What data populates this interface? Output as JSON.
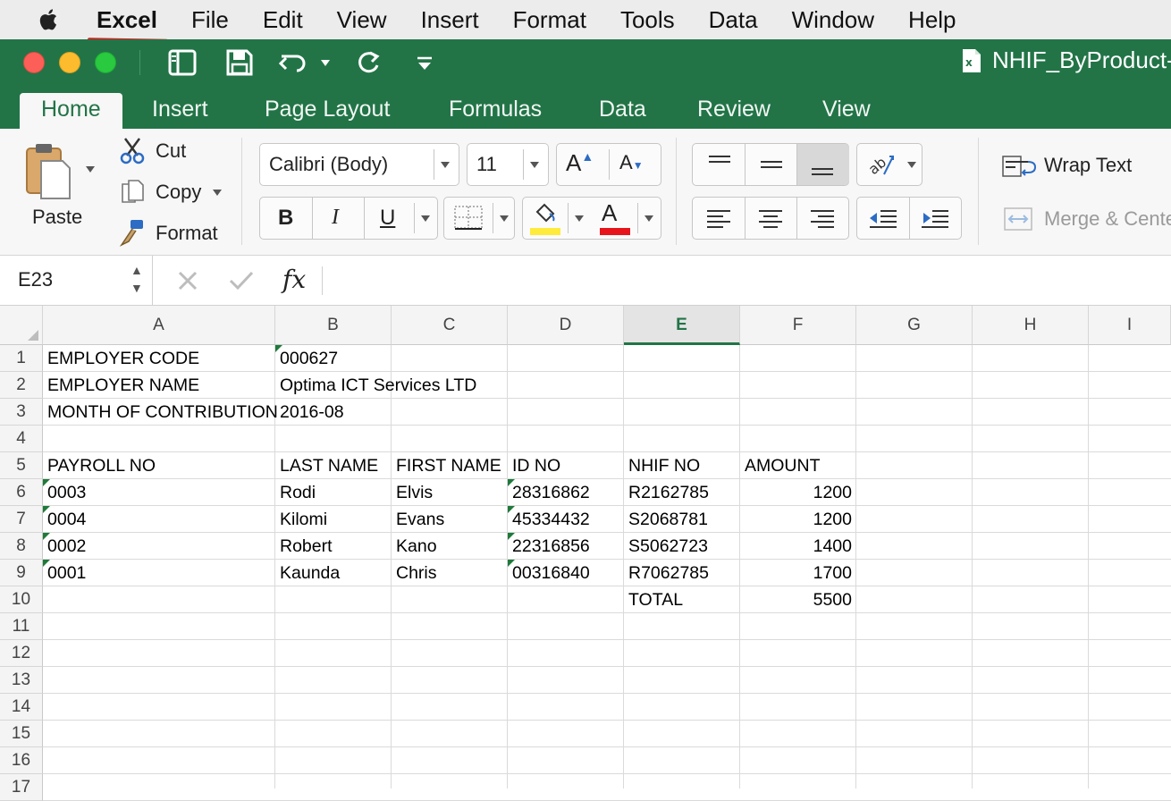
{
  "menubar": {
    "items": [
      "Excel",
      "File",
      "Edit",
      "View",
      "Insert",
      "Format",
      "Tools",
      "Data",
      "Window",
      "Help"
    ]
  },
  "window": {
    "title": "NHIF_ByProduct-"
  },
  "ribbon": {
    "tabs": [
      "Home",
      "Insert",
      "Page Layout",
      "Formulas",
      "Data",
      "Review",
      "View"
    ],
    "active_tab": "Home",
    "paste_label": "Paste",
    "cut_label": "Cut",
    "copy_label": "Copy",
    "format_label": "Format",
    "font_name": "Calibri (Body)",
    "font_size": "11",
    "bold": "B",
    "italic": "I",
    "underline": "U",
    "grow_font": "A",
    "shrink_font": "A",
    "font_color_glyph": "A",
    "wrap_text_label": "Wrap Text",
    "merge_label": "Merge & Cente",
    "highlight_color": "#ffeb3b",
    "font_color": "#e8141b"
  },
  "formula_bar": {
    "name_box": "E23",
    "fx": "fx",
    "value": ""
  },
  "sheet": {
    "columns": [
      "A",
      "B",
      "C",
      "D",
      "E",
      "F",
      "G",
      "H",
      "I"
    ],
    "selected_column": "E",
    "rows": [
      "1",
      "2",
      "3",
      "4",
      "5",
      "6",
      "7",
      "8",
      "9",
      "10",
      "11",
      "12",
      "13",
      "14",
      "15",
      "16",
      "17"
    ],
    "cells": {
      "A1": "EMPLOYER CODE",
      "B1": "000627",
      "A2": "EMPLOYER NAME",
      "B2": "Optima ICT Services LTD",
      "A3": "MONTH OF CONTRIBUTION",
      "B3": "2016-08",
      "A5": "PAYROLL NO",
      "B5": "LAST NAME",
      "C5": "FIRST NAME",
      "D5": "ID NO",
      "E5": "NHIF NO",
      "F5": "AMOUNT",
      "A6": "0003",
      "B6": "Rodi",
      "C6": "Elvis",
      "D6": "28316862",
      "E6": "R2162785",
      "F6": "1200",
      "A7": "0004",
      "B7": "Kilomi",
      "C7": "Evans",
      "D7": "45334432",
      "E7": "S2068781",
      "F7": "1200",
      "A8": "0002",
      "B8": "Robert",
      "C8": "Kano",
      "D8": "22316856",
      "E8": "S5062723",
      "F8": "1400",
      "A9": "0001",
      "B9": "Kaunda",
      "C9": "Chris",
      "D9": "00316840",
      "E9": "R7062785",
      "F9": "1700",
      "E10": "TOTAL",
      "F10": "5500"
    }
  }
}
